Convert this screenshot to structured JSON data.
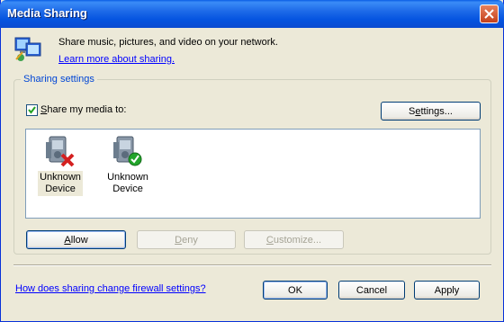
{
  "window": {
    "title": "Media Sharing"
  },
  "intro": {
    "text": "Share music, pictures, and video on your network.",
    "link": "Learn more about sharing."
  },
  "sharing_settings": {
    "group_label": "Sharing settings",
    "share_checkbox": {
      "label": "Share my media to:",
      "checked": true
    },
    "settings_button": "Settings...",
    "devices": [
      {
        "line1": "Unknown",
        "line2": "Device",
        "status": "denied",
        "selected": true
      },
      {
        "line1": "Unknown",
        "line2": "Device",
        "status": "allowed",
        "selected": false
      }
    ],
    "allow_button": "Allow",
    "deny_button": "Deny",
    "customize_button": "Customize..."
  },
  "footer": {
    "firewall_link": "How does sharing change firewall settings?",
    "ok_button": "OK",
    "cancel_button": "Cancel",
    "apply_button": "Apply"
  },
  "colors": {
    "titlebar": "#0554e0",
    "dialog_bg": "#ece9d8",
    "link": "#0000ff",
    "group_label": "#0046d5",
    "deny_mark": "#d42020",
    "allow_mark": "#22a52b"
  },
  "icons": [
    "media-sharing-icon",
    "close-icon",
    "checkmark-icon",
    "device-denied-icon",
    "device-allowed-icon"
  ]
}
